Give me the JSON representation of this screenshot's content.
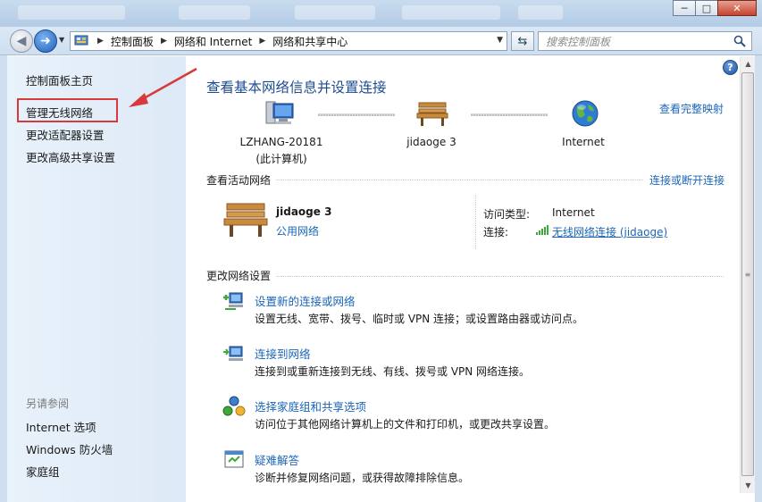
{
  "window": {
    "minimize_glyph": "─",
    "maximize_glyph": "□",
    "close_glyph": "✕"
  },
  "address_bar": {
    "breadcrumbs": [
      "控制面板",
      "网络和 Internet",
      "网络和共享中心"
    ],
    "search_placeholder": "搜索控制面板"
  },
  "sidebar": {
    "items": [
      {
        "label": "控制面板主页"
      },
      {
        "label": "管理无线网络"
      },
      {
        "label": "更改适配器设置"
      },
      {
        "label": "更改高级共享设置"
      }
    ],
    "see_also_heading": "另请参阅",
    "see_also": [
      {
        "label": "Internet 选项"
      },
      {
        "label": "Windows 防火墙"
      },
      {
        "label": "家庭组"
      }
    ]
  },
  "main": {
    "title": "查看基本网络信息并设置连接",
    "full_map_link": "查看完整映射",
    "help_glyph": "?",
    "map_nodes": {
      "computer": {
        "name": "LZHANG-20181",
        "sub": "(此计算机)"
      },
      "network": {
        "name": "jidaoge  3"
      },
      "internet": {
        "name": "Internet"
      }
    },
    "active_networks": {
      "heading": "查看活动网络",
      "connect_link": "连接或断开连接",
      "network_name": "jidaoge  3",
      "network_type": "公用网络",
      "access_type_label": "访问类型:",
      "access_type_value": "Internet",
      "connection_label": "连接:",
      "connection_value": "无线网络连接 (jidaoge)"
    },
    "change_settings": {
      "heading": "更改网络设置",
      "tasks": [
        {
          "title": "设置新的连接或网络",
          "desc": "设置无线、宽带、拨号、临时或 VPN 连接；或设置路由器或访问点。"
        },
        {
          "title": "连接到网络",
          "desc": "连接到或重新连接到无线、有线、拨号或 VPN 网络连接。"
        },
        {
          "title": "选择家庭组和共享选项",
          "desc": "访问位于其他网络计算机上的文件和打印机，或更改共享设置。"
        },
        {
          "title": "疑难解答",
          "desc": "诊断并修复网络问题，或获得故障排除信息。"
        }
      ]
    }
  },
  "colors": {
    "link": "#1c66b8",
    "title": "#1e4c91",
    "annotation": "#d63a3a"
  }
}
